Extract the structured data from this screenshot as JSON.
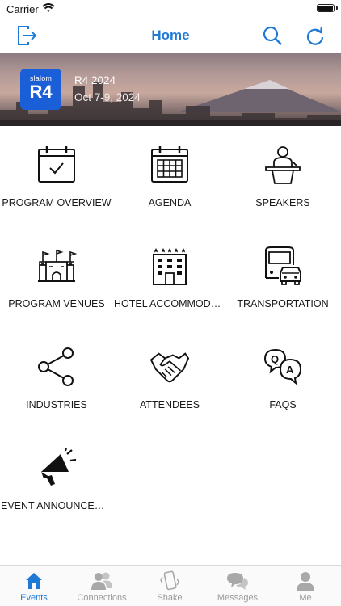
{
  "status": {
    "carrier": "Carrier"
  },
  "nav": {
    "title": "Home",
    "left_icon": "logout-icon",
    "search_icon": "search-icon",
    "refresh_icon": "refresh-icon",
    "accent": "#1f7ad6"
  },
  "banner": {
    "logo_top": "slalom",
    "logo_main": "R4",
    "event_name": "R4 2024",
    "dates": "Oct 7-9, 2024"
  },
  "tiles": [
    {
      "label": "PROGRAM OVERVIEW",
      "icon": "calendar-check-icon"
    },
    {
      "label": "AGENDA",
      "icon": "calendar-grid-icon"
    },
    {
      "label": "SPEAKERS",
      "icon": "podium-speaker-icon"
    },
    {
      "label": "PROGRAM VENUES",
      "icon": "venue-castle-icon"
    },
    {
      "label": "HOTEL ACCOMMODATI...",
      "icon": "hotel-icon"
    },
    {
      "label": "TRANSPORTATION",
      "icon": "bus-car-icon"
    },
    {
      "label": "INDUSTRIES",
      "icon": "share-nodes-icon"
    },
    {
      "label": "ATTENDEES",
      "icon": "handshake-icon"
    },
    {
      "label": "FAQS",
      "icon": "qa-bubbles-icon"
    },
    {
      "label": "EVENT ANNOUNCEMEN...",
      "icon": "megaphone-icon"
    }
  ],
  "tabs": [
    {
      "label": "Events",
      "icon": "home-icon",
      "active": true
    },
    {
      "label": "Connections",
      "icon": "people-icon",
      "active": false
    },
    {
      "label": "Shake",
      "icon": "phone-shake-icon",
      "active": false
    },
    {
      "label": "Messages",
      "icon": "chat-bubbles-icon",
      "active": false
    },
    {
      "label": "Me",
      "icon": "person-icon",
      "active": false
    }
  ]
}
